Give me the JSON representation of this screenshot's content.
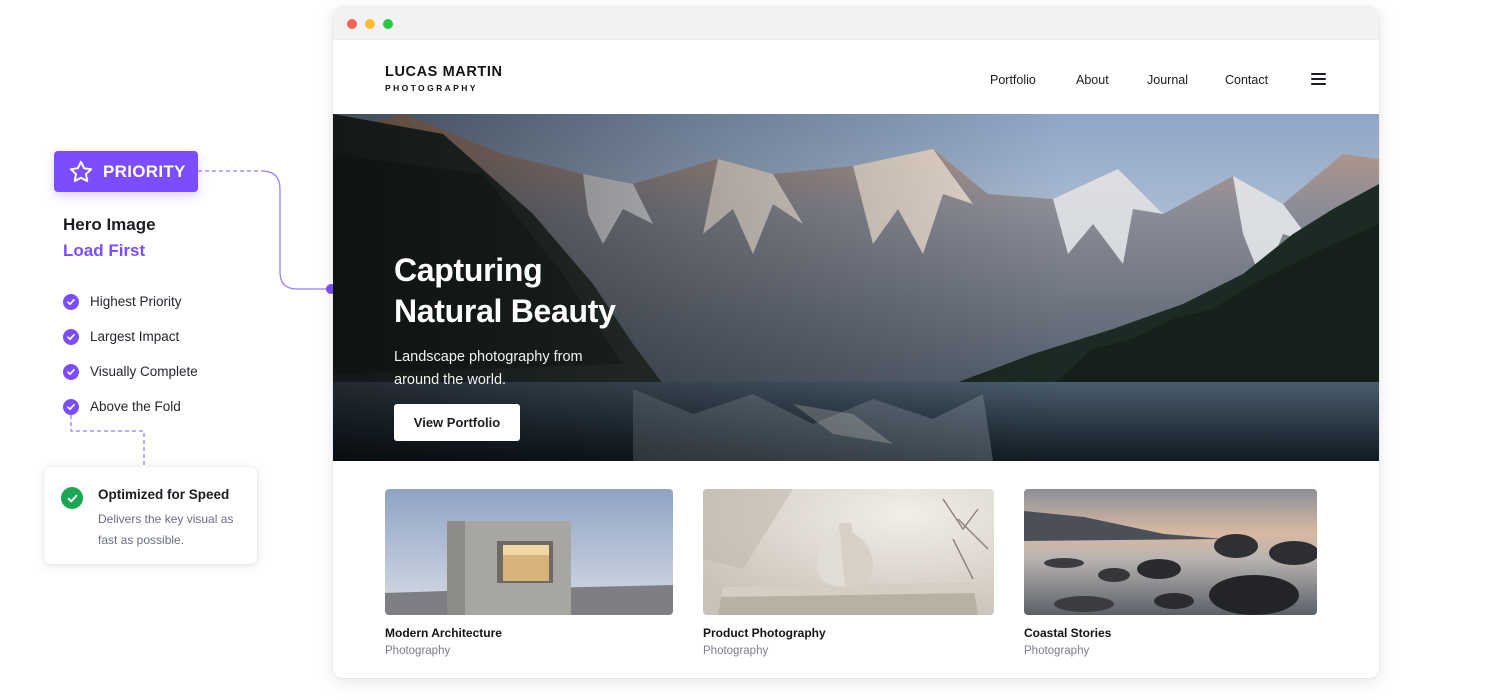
{
  "annotation": {
    "badge_label": "PRIORITY",
    "badge_icon": "star-icon",
    "title": "Hero Image",
    "subtitle": "Load First",
    "checks": [
      {
        "label": "Highest Priority"
      },
      {
        "label": "Largest Impact"
      },
      {
        "label": "Visually Complete"
      },
      {
        "label": "Above the Fold"
      }
    ],
    "card": {
      "title": "Optimized for Speed",
      "description": "Delivers the key visual as fast as possible."
    },
    "accent_color": "#7c4dff",
    "success_color": "#19a851"
  },
  "site": {
    "logo_name": "LUCAS MARTIN",
    "logo_sub": "PHOTOGRAPHY",
    "nav": [
      {
        "label": "Portfolio"
      },
      {
        "label": "About"
      },
      {
        "label": "Journal"
      },
      {
        "label": "Contact"
      }
    ],
    "menu_icon": "hamburger-menu-icon",
    "hero": {
      "heading_line1": "Capturing",
      "heading_line2": "Natural Beauty",
      "text": "Landscape photography from around the world.",
      "button": "View Portfolio"
    },
    "cards": [
      {
        "title": "Modern Architecture",
        "category": "Photography"
      },
      {
        "title": "Product Photography",
        "category": "Photography"
      },
      {
        "title": "Coastal Stories",
        "category": "Photography"
      }
    ]
  }
}
